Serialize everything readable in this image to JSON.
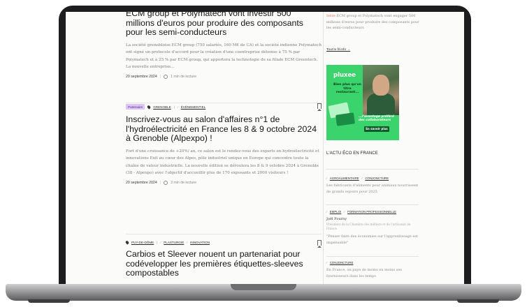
{
  "articles": [
    {
      "headline": "ECM group et Polymatech vont investir 500 millions d'euros pour produire des composants pour les semi-conducteurs",
      "excerpt": "La société grenobloise ECM group (750 salariés, 160 M€ de CA) et la société indienne Polymatech ont signé un protocole d'accord pour la création d'une coentreprise détenue à 75 % par Polymatech et à 25 % par ECM group, qui apportera la technologie de sa filiale ECM Greentech. La nouvelle entreprise...",
      "date": "20 septembre 2024",
      "read_time": "1 min de lecture"
    },
    {
      "badge": "Partenaire",
      "location": "GRENOBLE",
      "category": "ÉVÉNEMENTIEL",
      "headline": "Inscrivez-vous au salon d'affaires n°1 de l'hydroélectricité en France les 8 & 9 octobre 2024 à Grenoble (Alpexpo) !",
      "excerpt": "Fort d'une croissance de +20%/ an, ce salon est le rendez-vous des experts en hydroélectricité et innovations Exit au cœur des Alpes, pôle industriel unique en Europe qui concentre toute la chaîne de valeur industrielle. La nouvelle édition se déroulera les 8 & 9 octobre 2024 à Grenoble (38 - Alpexpo) avec l'objectif d'accueillir plus de 170 exposants et 2000 visiteurs !",
      "date": "20 septembre 2024",
      "read_time": "3 min de lecture"
    },
    {
      "location": "PUY-DE-DÔME",
      "category1": "PLASTURGIE",
      "category2": "INNOVATION",
      "headline": "Carbios et Sleever nouent un partenariat pour codévelopper les premières étiquettes-sleeves compostables"
    }
  ],
  "sidebar": {
    "top_excerpt_highlight": "Isère",
    "top_excerpt": " ECM group et Polymatech vont engager 500 millions d'euros pour produire des composants pour les semi-conducteurs",
    "see_all_link": "Tout le fil info →",
    "ad": {
      "brand": "pluxee",
      "copy": "Bien plus qu'un titre restaurant...",
      "tagline": "...l'avantage préféré des collaborateurs",
      "cta": "En savoir plus"
    },
    "section_title": "L'ACTU ÉCO EN FRANCE",
    "items": [
      {
        "tags": [
          "AGROALIMENTAIRE",
          "CONJONCTURE"
        ],
        "text": "Les fabricants d'aliments pour animaux nourrissent de grands espoirs pour 2025"
      },
      {
        "tags": [
          "EMPLOI",
          "FORMATION PROFESSIONNELLE"
        ],
        "name": "Joël Fourny",
        "role": "Président de la Chambre des métiers et de l'artisanat de France",
        "quote": "\"Penser faire des économies sur l'apprentissage est impensable\""
      },
      {
        "tags": [
          "CONJONCTURE"
        ],
        "text": "En France, on paye de moins en moins ses fournisseurs dans les temps"
      }
    ]
  }
}
